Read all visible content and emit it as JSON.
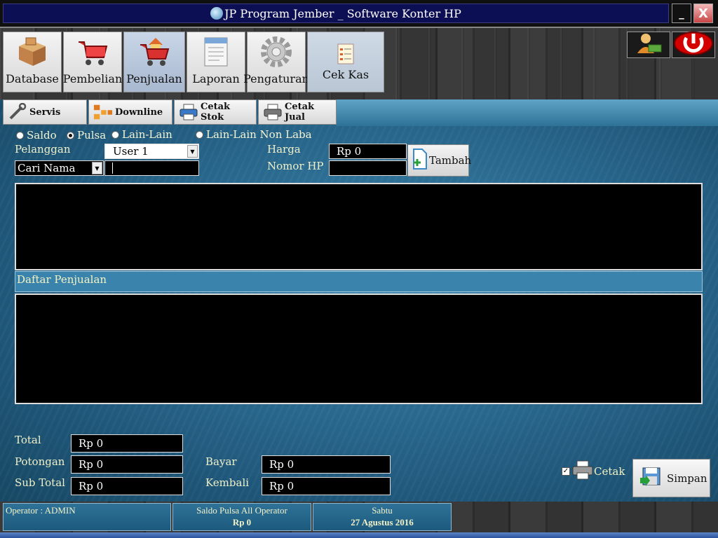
{
  "window": {
    "title": "JP Program Jember _ Software Konter HP",
    "min_label": "_",
    "close_label": "X"
  },
  "nav": [
    {
      "label": "Database",
      "icon": "boxes-icon"
    },
    {
      "label": "Pembelian",
      "icon": "cart-icon"
    },
    {
      "label": "Penjualan",
      "icon": "cart-house-icon",
      "active": true
    },
    {
      "label": "Laporan",
      "icon": "document-icon"
    },
    {
      "label": "Pengaturan",
      "icon": "gear-icon"
    },
    {
      "label": "Cek Kas",
      "icon": "checklist-icon"
    }
  ],
  "tabs": [
    {
      "label": "Servis",
      "icon": "wrench-icon"
    },
    {
      "label": "Downline",
      "icon": "network-icon"
    },
    {
      "label": "Cetak Stok",
      "icon": "printer-icon"
    },
    {
      "label": "Cetak Jual",
      "icon": "printer-icon"
    }
  ],
  "sale_type": {
    "options": [
      "Saldo",
      "Pulsa",
      "Lain-Lain",
      "Lain-Lain Non Laba"
    ],
    "selected": "Pulsa"
  },
  "form": {
    "pelanggan_label": "Pelanggan",
    "user_value": "User 1",
    "search_mode": "Cari Nama",
    "search_value": "",
    "harga_label": "Harga",
    "harga_value": "Rp 0",
    "nomor_label": "Nomor HP",
    "nomor_value": "",
    "tambah_label": "Tambah"
  },
  "daftar_label": "Daftar Penjualan",
  "totals": {
    "total_label": "Total",
    "total_value": "Rp 0",
    "potongan_label": "Potongan",
    "potongan_value": "Rp 0",
    "subtotal_label": "Sub Total",
    "subtotal_value": "Rp 0",
    "bayar_label": "Bayar",
    "bayar_value": "Rp 0",
    "kembali_label": "Kembali",
    "kembali_value": "Rp 0"
  },
  "cetak": {
    "label": "Cetak",
    "checked": true
  },
  "simpan_label": "Simpan",
  "status": {
    "operator": "Operator  :  ADMIN",
    "saldo_label": "Saldo Pulsa All Operator",
    "saldo_value": "Rp 0",
    "day": "Sabtu",
    "date": "27 Agustus 2016"
  }
}
